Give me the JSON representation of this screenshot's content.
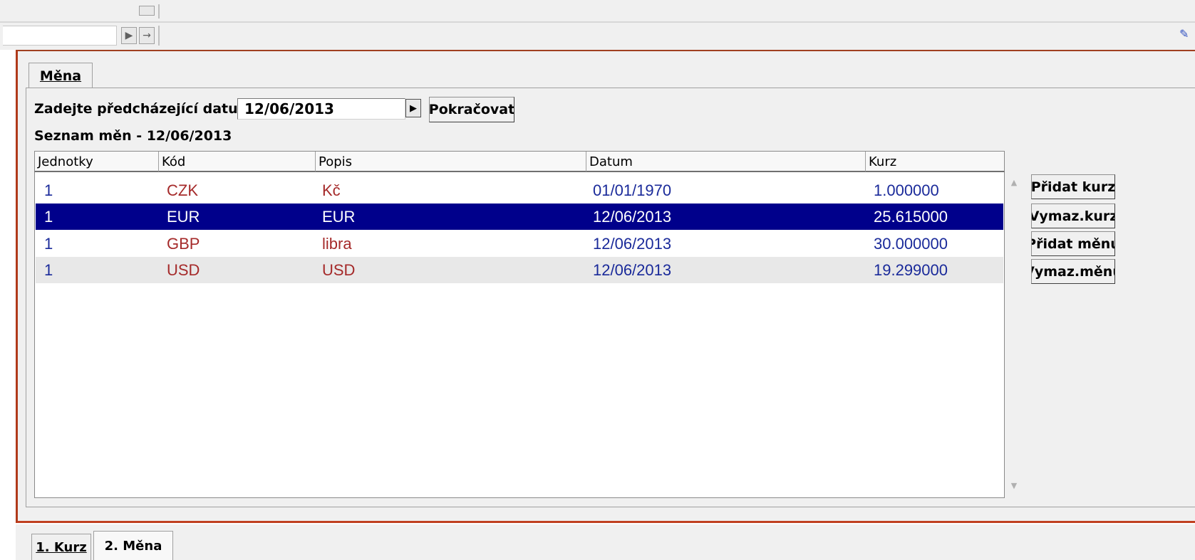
{
  "window": {
    "main_tab": "Měna",
    "bottom_tabs": [
      {
        "label": "1. Kurz"
      },
      {
        "label": "2. Měna"
      }
    ]
  },
  "form": {
    "date_label": "Zadejte předcházející datu",
    "date_value": "12/06/2013",
    "continue_button": "Pokračovat",
    "list_title": "Seznam měn - 12/06/2013"
  },
  "table": {
    "columns": [
      "Jednotky",
      "Kód",
      "Popis",
      "Datum",
      "Kurz"
    ],
    "rows": [
      {
        "units": "1",
        "code": "CZK",
        "desc": "Kč",
        "date": "01/01/1970",
        "rate": "1.000000"
      },
      {
        "units": "1",
        "code": "EUR",
        "desc": "EUR",
        "date": "12/06/2013",
        "rate": "25.615000"
      },
      {
        "units": "1",
        "code": "GBP",
        "desc": "libra",
        "date": "12/06/2013",
        "rate": "30.000000"
      },
      {
        "units": "1",
        "code": "USD",
        "desc": "USD",
        "date": "12/06/2013",
        "rate": "19.299000"
      }
    ],
    "selected_row_index": 1
  },
  "actions": {
    "add_rate": "Přidat kurz",
    "delete_rate": "Vymaz.kurz",
    "add_currency": "Přidat měnu",
    "delete_currency": "Vymaz.měnu"
  },
  "colors": {
    "selected_row_bg": "#00008b",
    "code_text": "#a52a2a",
    "date_text": "#1a2a9a",
    "frame_accent": "#b03a1a"
  },
  "icons": {
    "toolbar": [
      "play-icon",
      "arrow-right-icon"
    ],
    "date_picker": "play-icon",
    "scroll": [
      "scroll-up-icon",
      "scroll-down-icon"
    ]
  }
}
